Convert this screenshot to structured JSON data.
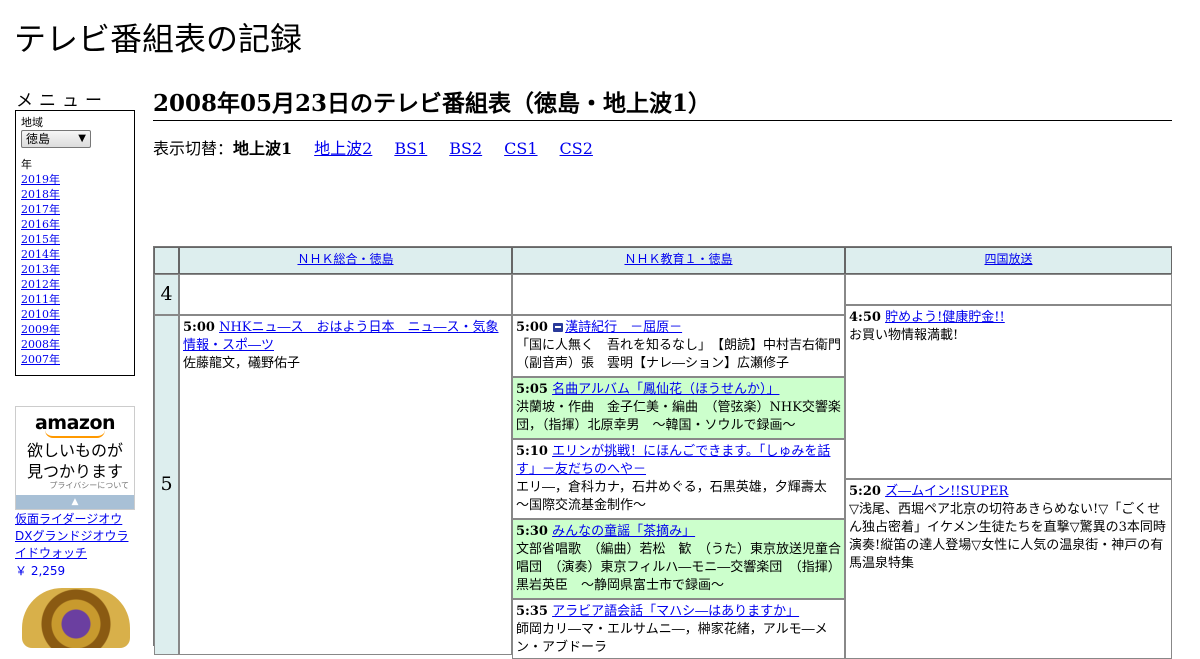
{
  "site": {
    "title": "テレビ番組表の記録"
  },
  "menu": {
    "heading": "メニュー",
    "region_label": "地域",
    "region_selected": "徳島",
    "year_label": "年",
    "years": [
      "2019年",
      "2018年",
      "2017年",
      "2016年",
      "2015年",
      "2014年",
      "2013年",
      "2012年",
      "2011年",
      "2010年",
      "2009年",
      "2008年",
      "2007年"
    ]
  },
  "ad": {
    "logo": "amazon",
    "copy_line1": "欲しいものが",
    "copy_line2": "見つかります",
    "privacy": "プライバシーについて",
    "product_name": "仮面ライダージオウ DXグランドジオウライドウォッチ",
    "product_price": "￥ 2,259"
  },
  "page": {
    "title": "2008年05月23日のテレビ番組表（徳島・地上波1）"
  },
  "switcher": {
    "label": "表示切替：",
    "current": "地上波1",
    "links": [
      "地上波2",
      "BS1",
      "BS2",
      "CS1",
      "CS2"
    ]
  },
  "schedule": {
    "channels": [
      "ＮＨＫ総合・徳島",
      "ＮＨＫ教育１・徳島",
      "四国放送"
    ],
    "hours": [
      "4",
      "5"
    ],
    "programs": {
      "nhk_sogo": [
        {
          "time": "5:00",
          "title": "NHKニュ―ス　おはよう日本　ニュ―ス・気象情報・スポ―ツ",
          "desc": "佐藤龍文，礒野佑子"
        }
      ],
      "nhk_kyoiku": [
        {
          "time": "5:00",
          "title": "漢詩紀行　－屈原－",
          "desc": "「国に人無く　吾れを知るなし」　【朗読】中村吉右衛門　（副音声）張　雲明【ナレ―ション】広瀬修子"
        },
        {
          "time": "5:05",
          "title": "名曲アルバム「鳳仙花（ほうせんか）」",
          "desc": "洪蘭坡・作曲　金子仁美・編曲　（管弦楽）NHK交響楽団，（指揮）北原幸男　～韓国・ソウルで録画～"
        },
        {
          "time": "5:10",
          "title": "エリンが挑戦！にほんごできます。「しゅみを話す」－友だちのへや－",
          "desc": "エリ―，倉科カナ，石井めぐる，石黒英雄，夕輝壽太　～国際交流基金制作～"
        },
        {
          "time": "5:30",
          "title": "みんなの童謡「茶摘み」",
          "desc": "文部省唱歌　（編曲）若松　歓　（うた）東京放送児童合唱団　（演奏）東京フィルハ―モニ―交響楽団　（指揮）黒岩英臣　～静岡県富士市で録画～"
        },
        {
          "time": "5:35",
          "title": "アラビア語会話「マハシ―はありますか」",
          "desc": "師岡カリ―マ・エルサムニ―，榊家花緒，アルモ―メン・アブドーラ"
        }
      ],
      "shikoku": [
        {
          "time": "4:50",
          "title": "貯めよう!健康貯金!!",
          "desc": "お買い物情報満載!"
        },
        {
          "time": "5:20",
          "title": "ズ―ムイン!!SUPER",
          "desc": "▽浅尾、西堀ペア北京の切符あきらめない!▽「ごくせん独占密着」イケメン生徒たちを直撃▽驚異の3本同時演奏!縦笛の達人登場▽女性に人気の温泉街・神戸の有馬温泉特集"
        }
      ]
    }
  }
}
